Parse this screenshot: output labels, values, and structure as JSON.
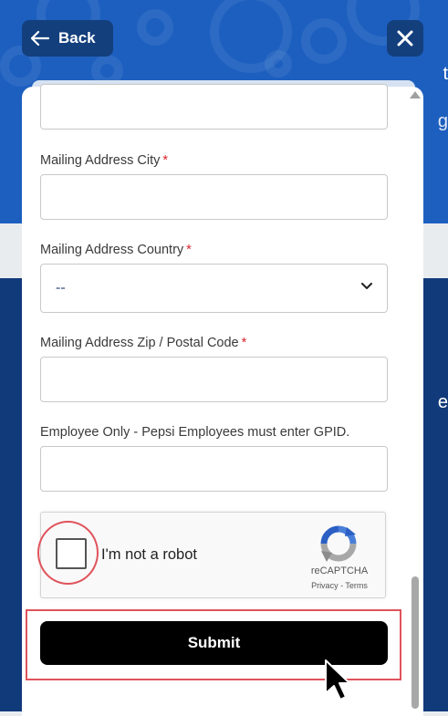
{
  "header": {
    "back_label": "Back",
    "edge_char_1": "t",
    "edge_char_2": "g",
    "edge_char_3": "e"
  },
  "form": {
    "fields": [
      {
        "label": "Mailing Address City",
        "required_mark": "*",
        "value": ""
      },
      {
        "label": "Mailing Address Country",
        "required_mark": "*",
        "selected": "--"
      },
      {
        "label": "Mailing Address Zip / Postal Code",
        "required_mark": "*",
        "value": ""
      },
      {
        "label": "Employee Only - Pepsi Employees must enter GPID.",
        "value": ""
      }
    ],
    "captcha": {
      "checkbox_label": "I'm not a robot",
      "brand": "reCAPTCHA",
      "privacy": "Privacy",
      "separator": " - ",
      "terms": "Terms"
    },
    "submit_label": "Submit"
  },
  "colors": {
    "header_blue": "#1d5fbf",
    "button_navy": "#133f7d",
    "required_red": "#d9232e",
    "highlight_red": "#e0535b",
    "submit_black": "#000000"
  },
  "icons": [
    "arrow-left-icon",
    "close-icon",
    "chevron-down-icon",
    "recaptcha-logo-icon",
    "mouse-cursor-icon"
  ]
}
